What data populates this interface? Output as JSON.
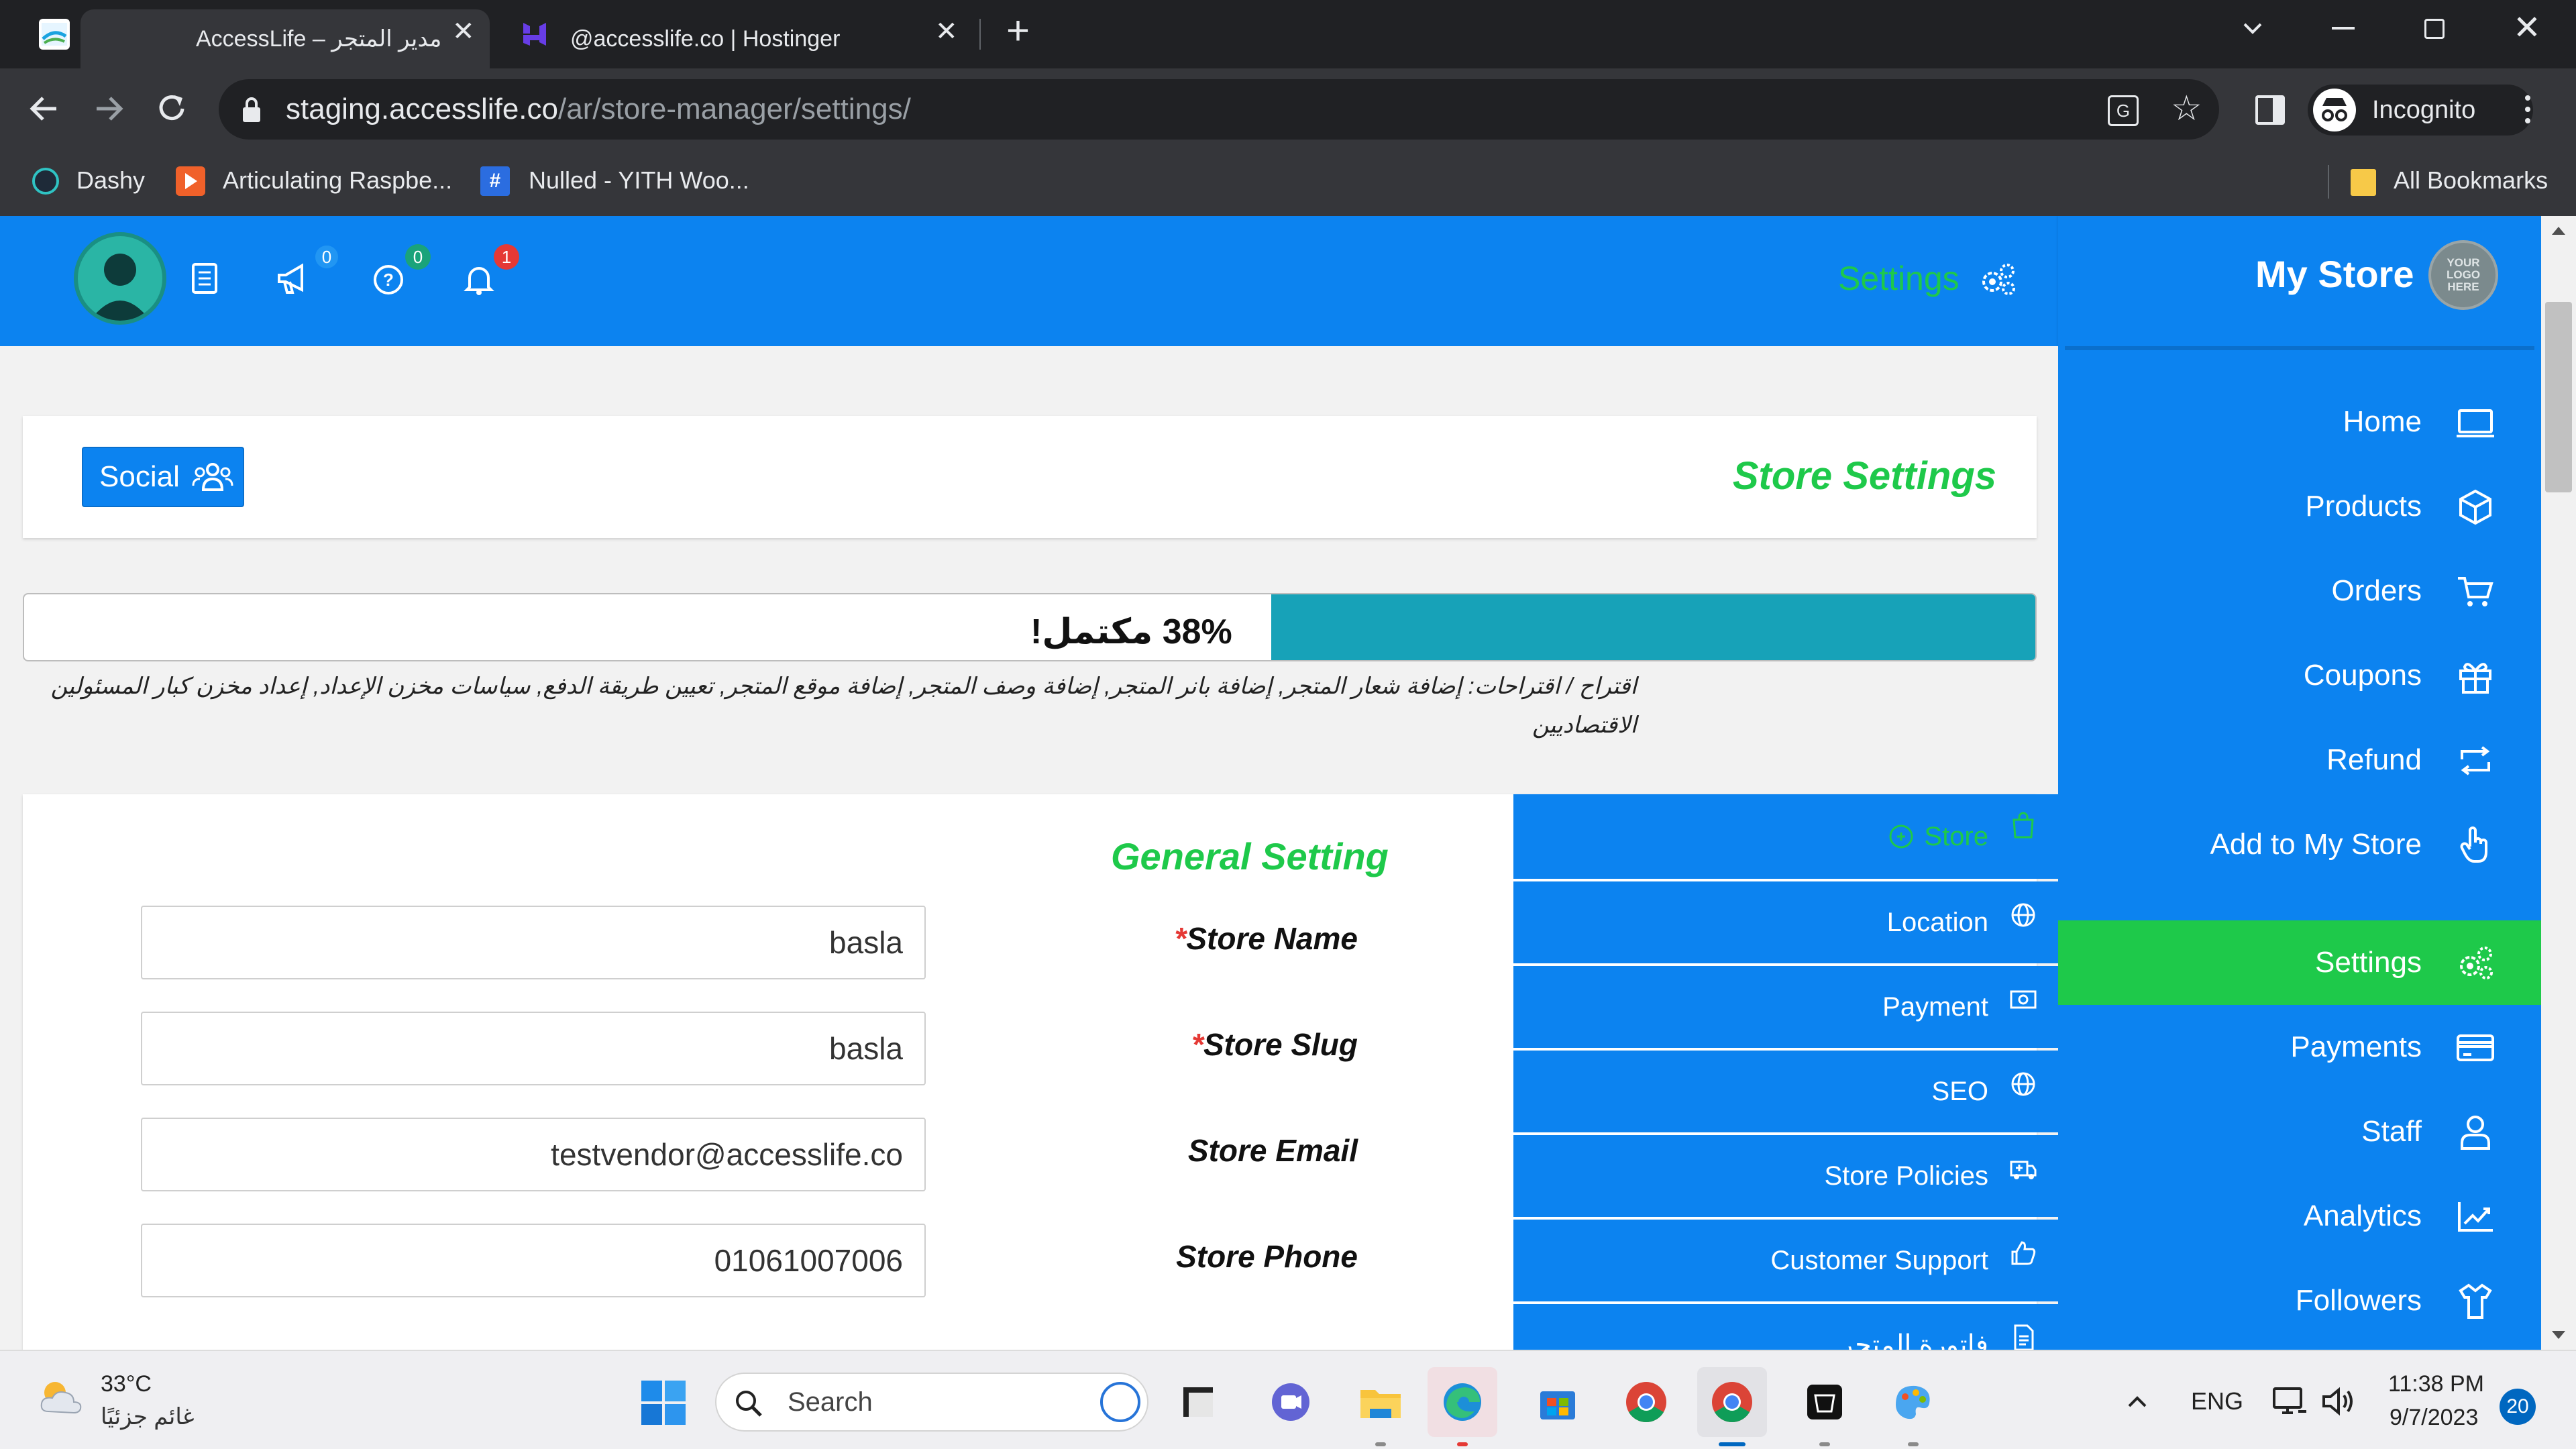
{
  "browser": {
    "tabs": [
      {
        "title": "AccessLife – مدير المتجر",
        "favicon": "accesslife-logo-icon"
      },
      {
        "title": "@accesslife.co | Hostinger",
        "favicon": "hostinger-logo-icon"
      }
    ],
    "url_host": "staging.accesslife.co",
    "url_path": "/ar/store-manager/settings/",
    "profile_label": "Incognito",
    "bookmarks": [
      {
        "label": "Dashy",
        "icon": "dashy-icon"
      },
      {
        "label": "Articulating Raspbe...",
        "icon": "article-icon"
      },
      {
        "label": "Nulled - YITH Woo...",
        "icon": "nulled-icon"
      }
    ],
    "all_bookmarks_label": "All Bookmarks"
  },
  "header": {
    "settings_label": "Settings",
    "store_title": "My Store",
    "store_logo_text": "YOUR LOGO HERE",
    "badges": {
      "announcements": "0",
      "enquiries": "0",
      "notifications": "1"
    }
  },
  "sidebar": {
    "items": [
      {
        "label": "Home",
        "icon": "monitor-icon"
      },
      {
        "label": "Products",
        "icon": "cube-icon"
      },
      {
        "label": "Orders",
        "icon": "cart-icon"
      },
      {
        "label": "Coupons",
        "icon": "gift-icon"
      },
      {
        "label": "Refund",
        "icon": "retweet-icon"
      },
      {
        "label": "Add to My Store",
        "icon": "hand-pointer-icon"
      },
      {
        "label": "Settings",
        "icon": "cogs-icon"
      },
      {
        "label": "Payments",
        "icon": "credit-card-icon"
      },
      {
        "label": "Staff",
        "icon": "user-icon"
      },
      {
        "label": "Analytics",
        "icon": "chart-line-icon"
      },
      {
        "label": "Followers",
        "icon": "followers-icon"
      }
    ],
    "active": "Settings",
    "active_color": "#1ec94a",
    "accent_color": "#0c83f0"
  },
  "settings_panel": {
    "title": "Store Settings",
    "social_button": "Social"
  },
  "progress": {
    "percent": 38,
    "label": "38% مكتمل!",
    "suggestions": "اقتراح / اقتراحات: إضافة شعار المتجر, إضافة بانر المتجر, إضافة وصف المتجر, إضافة موقع المتجر, تعيين طريقة الدفع, سياسات مخزن الإعداد, إعداد مخزن كبار المسئولين الاقتصاديين",
    "fill_color": "#17a2b8"
  },
  "settings_menu": [
    {
      "label": "Store",
      "icon": "shopping-bag-icon",
      "active": true
    },
    {
      "label": "Location",
      "icon": "globe-icon"
    },
    {
      "label": "Payment",
      "icon": "money-icon"
    },
    {
      "label": "SEO",
      "icon": "globe-icon"
    },
    {
      "label": "Store Policies",
      "icon": "ambulance-icon"
    },
    {
      "label": "Customer Support",
      "icon": "thumbs-up-icon"
    },
    {
      "label": "فاتورة المتجر",
      "icon": "invoice-icon"
    }
  ],
  "general": {
    "heading": "General Setting",
    "fields": [
      {
        "label": "Store Name",
        "required": true,
        "value": "basla"
      },
      {
        "label": "Store Slug",
        "required": true,
        "value": "basla"
      },
      {
        "label": "Store Email",
        "required": false,
        "value": "testvendor@accesslife.co"
      },
      {
        "label": "Store Phone",
        "required": false,
        "value": "01061007006"
      }
    ]
  },
  "taskbar": {
    "weather_temp": "33°C",
    "weather_desc": "غائم جزئيًا",
    "search_label": "Search",
    "language": "ENG",
    "time": "11:38 PM",
    "date": "9/7/2023",
    "notification_count": "20"
  }
}
